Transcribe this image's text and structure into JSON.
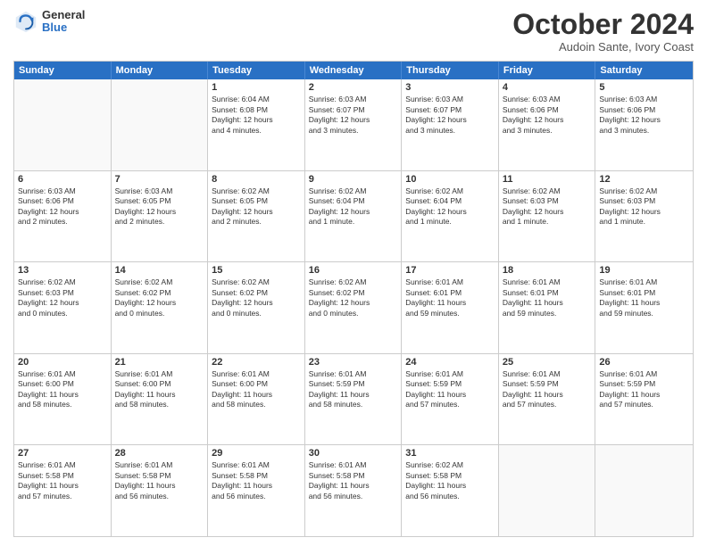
{
  "header": {
    "logo_general": "General",
    "logo_blue": "Blue",
    "month_title": "October 2024",
    "subtitle": "Audoin Sante, Ivory Coast"
  },
  "days_of_week": [
    "Sunday",
    "Monday",
    "Tuesday",
    "Wednesday",
    "Thursday",
    "Friday",
    "Saturday"
  ],
  "rows": [
    [
      {
        "day": "",
        "empty": true,
        "lines": []
      },
      {
        "day": "",
        "empty": true,
        "lines": []
      },
      {
        "day": "1",
        "empty": false,
        "lines": [
          "Sunrise: 6:04 AM",
          "Sunset: 6:08 PM",
          "Daylight: 12 hours",
          "and 4 minutes."
        ]
      },
      {
        "day": "2",
        "empty": false,
        "lines": [
          "Sunrise: 6:03 AM",
          "Sunset: 6:07 PM",
          "Daylight: 12 hours",
          "and 3 minutes."
        ]
      },
      {
        "day": "3",
        "empty": false,
        "lines": [
          "Sunrise: 6:03 AM",
          "Sunset: 6:07 PM",
          "Daylight: 12 hours",
          "and 3 minutes."
        ]
      },
      {
        "day": "4",
        "empty": false,
        "lines": [
          "Sunrise: 6:03 AM",
          "Sunset: 6:06 PM",
          "Daylight: 12 hours",
          "and 3 minutes."
        ]
      },
      {
        "day": "5",
        "empty": false,
        "lines": [
          "Sunrise: 6:03 AM",
          "Sunset: 6:06 PM",
          "Daylight: 12 hours",
          "and 3 minutes."
        ]
      }
    ],
    [
      {
        "day": "6",
        "empty": false,
        "lines": [
          "Sunrise: 6:03 AM",
          "Sunset: 6:06 PM",
          "Daylight: 12 hours",
          "and 2 minutes."
        ]
      },
      {
        "day": "7",
        "empty": false,
        "lines": [
          "Sunrise: 6:03 AM",
          "Sunset: 6:05 PM",
          "Daylight: 12 hours",
          "and 2 minutes."
        ]
      },
      {
        "day": "8",
        "empty": false,
        "lines": [
          "Sunrise: 6:02 AM",
          "Sunset: 6:05 PM",
          "Daylight: 12 hours",
          "and 2 minutes."
        ]
      },
      {
        "day": "9",
        "empty": false,
        "lines": [
          "Sunrise: 6:02 AM",
          "Sunset: 6:04 PM",
          "Daylight: 12 hours",
          "and 1 minute."
        ]
      },
      {
        "day": "10",
        "empty": false,
        "lines": [
          "Sunrise: 6:02 AM",
          "Sunset: 6:04 PM",
          "Daylight: 12 hours",
          "and 1 minute."
        ]
      },
      {
        "day": "11",
        "empty": false,
        "lines": [
          "Sunrise: 6:02 AM",
          "Sunset: 6:03 PM",
          "Daylight: 12 hours",
          "and 1 minute."
        ]
      },
      {
        "day": "12",
        "empty": false,
        "lines": [
          "Sunrise: 6:02 AM",
          "Sunset: 6:03 PM",
          "Daylight: 12 hours",
          "and 1 minute."
        ]
      }
    ],
    [
      {
        "day": "13",
        "empty": false,
        "lines": [
          "Sunrise: 6:02 AM",
          "Sunset: 6:03 PM",
          "Daylight: 12 hours",
          "and 0 minutes."
        ]
      },
      {
        "day": "14",
        "empty": false,
        "lines": [
          "Sunrise: 6:02 AM",
          "Sunset: 6:02 PM",
          "Daylight: 12 hours",
          "and 0 minutes."
        ]
      },
      {
        "day": "15",
        "empty": false,
        "lines": [
          "Sunrise: 6:02 AM",
          "Sunset: 6:02 PM",
          "Daylight: 12 hours",
          "and 0 minutes."
        ]
      },
      {
        "day": "16",
        "empty": false,
        "lines": [
          "Sunrise: 6:02 AM",
          "Sunset: 6:02 PM",
          "Daylight: 12 hours",
          "and 0 minutes."
        ]
      },
      {
        "day": "17",
        "empty": false,
        "lines": [
          "Sunrise: 6:01 AM",
          "Sunset: 6:01 PM",
          "Daylight: 11 hours",
          "and 59 minutes."
        ]
      },
      {
        "day": "18",
        "empty": false,
        "lines": [
          "Sunrise: 6:01 AM",
          "Sunset: 6:01 PM",
          "Daylight: 11 hours",
          "and 59 minutes."
        ]
      },
      {
        "day": "19",
        "empty": false,
        "lines": [
          "Sunrise: 6:01 AM",
          "Sunset: 6:01 PM",
          "Daylight: 11 hours",
          "and 59 minutes."
        ]
      }
    ],
    [
      {
        "day": "20",
        "empty": false,
        "lines": [
          "Sunrise: 6:01 AM",
          "Sunset: 6:00 PM",
          "Daylight: 11 hours",
          "and 58 minutes."
        ]
      },
      {
        "day": "21",
        "empty": false,
        "lines": [
          "Sunrise: 6:01 AM",
          "Sunset: 6:00 PM",
          "Daylight: 11 hours",
          "and 58 minutes."
        ]
      },
      {
        "day": "22",
        "empty": false,
        "lines": [
          "Sunrise: 6:01 AM",
          "Sunset: 6:00 PM",
          "Daylight: 11 hours",
          "and 58 minutes."
        ]
      },
      {
        "day": "23",
        "empty": false,
        "lines": [
          "Sunrise: 6:01 AM",
          "Sunset: 5:59 PM",
          "Daylight: 11 hours",
          "and 58 minutes."
        ]
      },
      {
        "day": "24",
        "empty": false,
        "lines": [
          "Sunrise: 6:01 AM",
          "Sunset: 5:59 PM",
          "Daylight: 11 hours",
          "and 57 minutes."
        ]
      },
      {
        "day": "25",
        "empty": false,
        "lines": [
          "Sunrise: 6:01 AM",
          "Sunset: 5:59 PM",
          "Daylight: 11 hours",
          "and 57 minutes."
        ]
      },
      {
        "day": "26",
        "empty": false,
        "lines": [
          "Sunrise: 6:01 AM",
          "Sunset: 5:59 PM",
          "Daylight: 11 hours",
          "and 57 minutes."
        ]
      }
    ],
    [
      {
        "day": "27",
        "empty": false,
        "lines": [
          "Sunrise: 6:01 AM",
          "Sunset: 5:58 PM",
          "Daylight: 11 hours",
          "and 57 minutes."
        ]
      },
      {
        "day": "28",
        "empty": false,
        "lines": [
          "Sunrise: 6:01 AM",
          "Sunset: 5:58 PM",
          "Daylight: 11 hours",
          "and 56 minutes."
        ]
      },
      {
        "day": "29",
        "empty": false,
        "lines": [
          "Sunrise: 6:01 AM",
          "Sunset: 5:58 PM",
          "Daylight: 11 hours",
          "and 56 minutes."
        ]
      },
      {
        "day": "30",
        "empty": false,
        "lines": [
          "Sunrise: 6:01 AM",
          "Sunset: 5:58 PM",
          "Daylight: 11 hours",
          "and 56 minutes."
        ]
      },
      {
        "day": "31",
        "empty": false,
        "lines": [
          "Sunrise: 6:02 AM",
          "Sunset: 5:58 PM",
          "Daylight: 11 hours",
          "and 56 minutes."
        ]
      },
      {
        "day": "",
        "empty": true,
        "lines": []
      },
      {
        "day": "",
        "empty": true,
        "lines": []
      }
    ]
  ]
}
